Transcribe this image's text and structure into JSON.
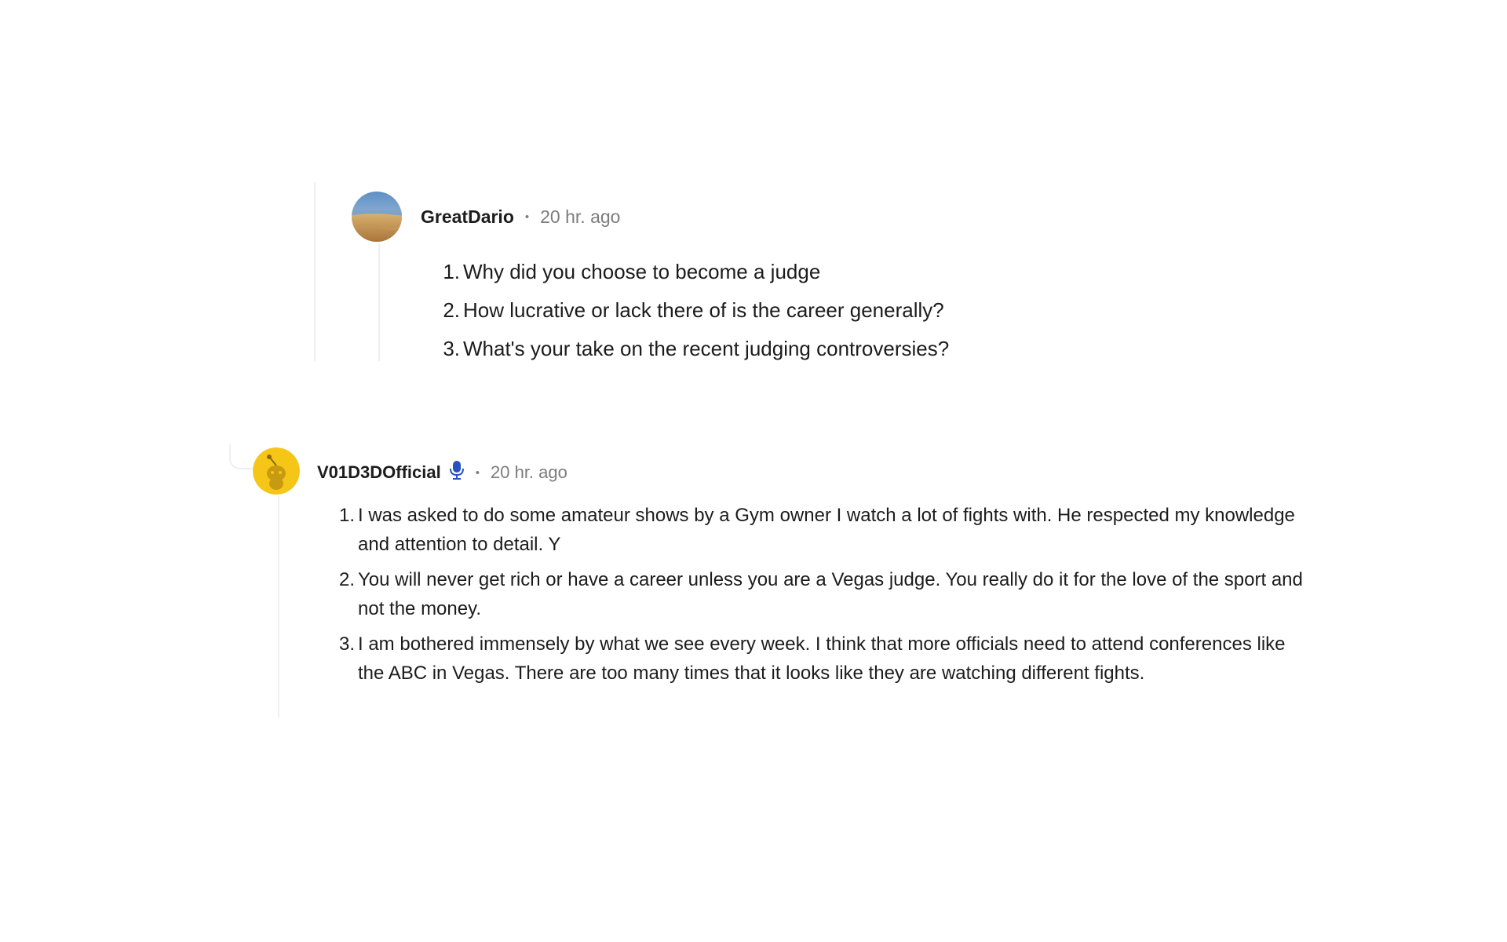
{
  "comments": [
    {
      "username": "GreatDario",
      "separator": "•",
      "timestamp": "20 hr. ago",
      "avatar_icon": "beach-avatar-icon",
      "items": [
        {
          "num": "1.",
          "text": "Why did you choose to become a judge"
        },
        {
          "num": "2.",
          "text": "How lucrative or lack there of is the career generally?"
        },
        {
          "num": "3.",
          "text": "What's your take on the recent judging controversies?"
        }
      ]
    },
    {
      "username": "V01D3DOfficial",
      "separator": "•",
      "timestamp": "20 hr. ago",
      "avatar_icon": "snoo-avatar-icon",
      "badge_icon": "microphone-icon",
      "items": [
        {
          "num": "1.",
          "text": "I was asked to do some amateur shows by a Gym owner I watch a lot of fights with. He respected my knowledge and attention to detail. Y"
        },
        {
          "num": "2.",
          "text": "You will never get rich or have a career unless you are a Vegas judge. You really do it for the love of the sport and not the money."
        },
        {
          "num": "3.",
          "text": "I am bothered immensely by what we see every week. I think that more officials need to attend conferences like the ABC in Vegas. There are too many times that it looks like they are watching different fights."
        }
      ]
    }
  ],
  "colors": {
    "text": "#1c1c1c",
    "meta": "#7c7c7c",
    "thread": "#edeff1",
    "mod_blue": "#2a52be",
    "snoo_yellow": "#f5c518"
  }
}
